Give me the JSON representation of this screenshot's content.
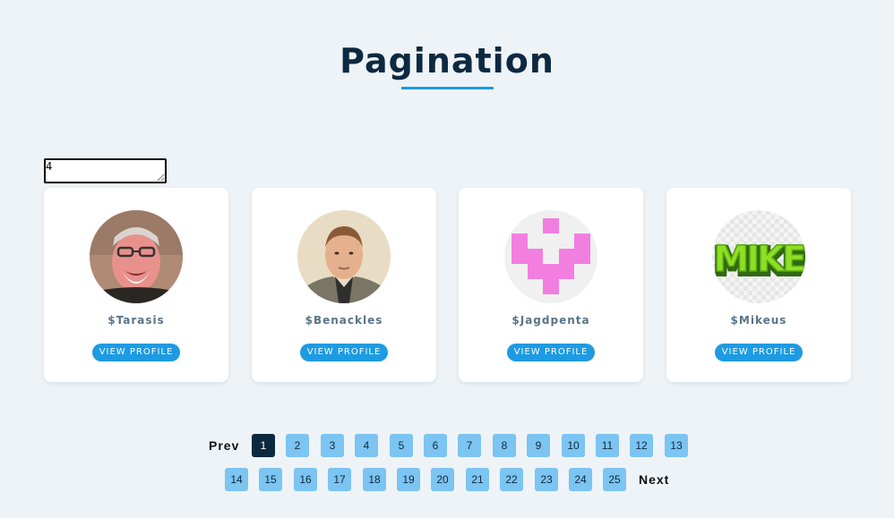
{
  "header": {
    "title": "Pagination"
  },
  "count_input": {
    "value": "4"
  },
  "cards": [
    {
      "username": "$Tarasis",
      "button_label": "VIEW PROFILE",
      "avatar": "photo-older-man-glasses"
    },
    {
      "username": "$Benackles",
      "button_label": "VIEW PROFILE",
      "avatar": "photo-young-man"
    },
    {
      "username": "$Jagdpenta",
      "button_label": "VIEW PROFILE",
      "avatar": "pink-identicon"
    },
    {
      "username": "$Mikeus",
      "button_label": "VIEW PROFILE",
      "avatar": "mike-green-logo"
    }
  ],
  "pagination": {
    "prev_label": "Prev",
    "next_label": "Next",
    "active_page": "1",
    "pages": [
      "1",
      "2",
      "3",
      "4",
      "5",
      "6",
      "7",
      "8",
      "9",
      "10",
      "11",
      "12",
      "13",
      "14",
      "15",
      "16",
      "17",
      "18",
      "19",
      "20",
      "21",
      "22",
      "23",
      "24",
      "25"
    ]
  },
  "colors": {
    "background": "#eef3f7",
    "title": "#0d2940",
    "accent": "#1d9be2",
    "page_button": "#7cc4f1",
    "page_active": "#0d2940"
  }
}
